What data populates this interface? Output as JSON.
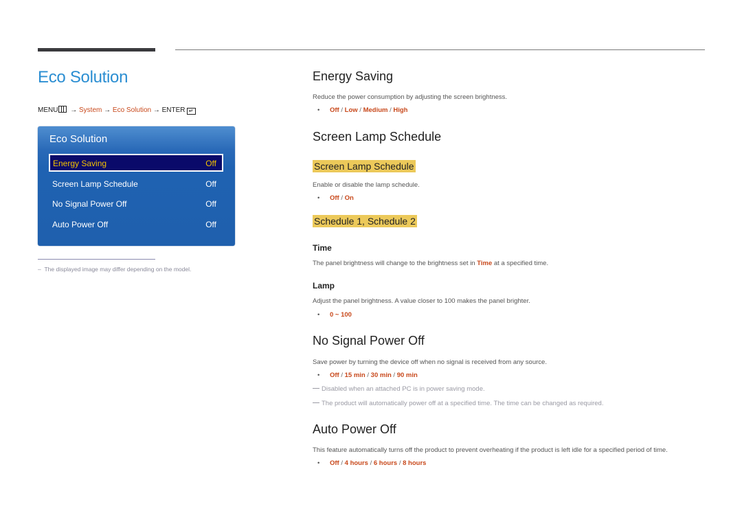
{
  "page": {
    "title": "Eco Solution",
    "menu_path": {
      "menu_label": "MENU",
      "menu_icon": "menu-grid-icon",
      "arrow": "→",
      "steps": [
        "System",
        "Eco Solution"
      ],
      "enter_label": "ENTER",
      "enter_icon": "enter-icon"
    }
  },
  "osd": {
    "title": "Eco Solution",
    "items": [
      {
        "label": "Energy Saving",
        "value": "Off",
        "selected": true
      },
      {
        "label": "Screen Lamp Schedule",
        "value": "Off",
        "selected": false
      },
      {
        "label": "No Signal Power Off",
        "value": "Off",
        "selected": false
      },
      {
        "label": "Auto Power Off",
        "value": "Off",
        "selected": false
      }
    ]
  },
  "footnote": "The displayed image may differ depending on the model.",
  "sections": {
    "energy_saving": {
      "title": "Energy Saving",
      "description": "Reduce the power consumption by adjusting the screen brightness.",
      "options": [
        "Off",
        "Low",
        "Medium",
        "High"
      ]
    },
    "screen_lamp_schedule": {
      "title": "Screen Lamp Schedule",
      "sub_title": "Screen Lamp Schedule",
      "description": "Enable or disable the lamp schedule.",
      "options": [
        "Off",
        "On"
      ],
      "schedule_title": "Schedule 1, Schedule 2",
      "time": {
        "title": "Time",
        "desc_before": "The panel brightness will change to the brightness set in ",
        "desc_highlight": "Time",
        "desc_after": " at a specified time."
      },
      "lamp": {
        "title": "Lamp",
        "description": "Adjust the panel brightness. A value closer to 100 makes the panel brighter.",
        "range": "0 ~ 100"
      }
    },
    "no_signal_power_off": {
      "title": "No Signal Power Off",
      "description": "Save power by turning the device off when no signal is received from any source.",
      "options": [
        "Off",
        "15 min",
        "30 min",
        "90 min"
      ],
      "notes": [
        "Disabled when an attached PC is in power saving mode.",
        "The product will automatically power off at a specified time. The time can be changed as required."
      ]
    },
    "auto_power_off": {
      "title": "Auto Power Off",
      "description": "This feature automatically turns off the product to prevent overheating if the product is left idle for a specified period of time.",
      "options": [
        "Off",
        "4 hours",
        "6 hours",
        "8 hours"
      ]
    }
  },
  "colors": {
    "title_blue": "#2b8ed2",
    "accent_orange": "#c8491c",
    "highlight_yellow": "#ecc95a",
    "osd_blue": "#1f62b2",
    "osd_selected_bg": "#0a0a6a",
    "osd_selected_text": "#f4c200"
  }
}
